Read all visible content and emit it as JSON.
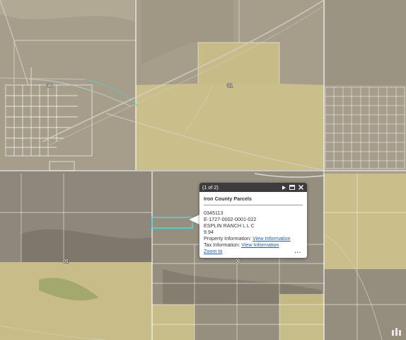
{
  "map": {
    "section_labels": [
      "36",
      "31",
      "01",
      "06"
    ],
    "colors": {
      "terrain": "#a69d8a",
      "terrain_dark": "#8f877a",
      "yellow_parcel": "#d2c78a",
      "parcel_line": "#ffffff",
      "selected_parcel": "#4fd8d8"
    }
  },
  "popup": {
    "count": "(1 of 2)",
    "title": "Iron County Parcels",
    "parcel_id": "0345113",
    "parcel_code": "E-1727-0002-0001-022",
    "owner": "ESPLIN RANCH L L C",
    "acres": "9.94",
    "property_info_label": "Property Information:",
    "property_info_link": "View Information",
    "tax_info_label": "Tax Information:",
    "tax_info_link": "View Information",
    "zoom_label": "Zoom to",
    "more_label": "..."
  }
}
